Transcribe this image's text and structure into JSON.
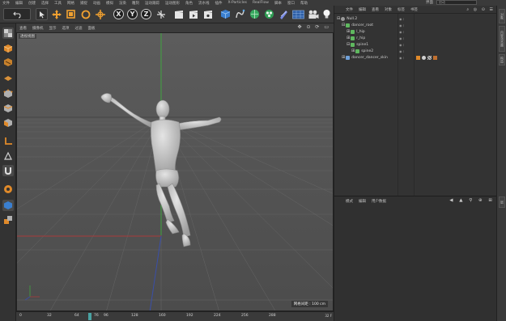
{
  "menu": {
    "items": [
      "文件",
      "编辑",
      "创建",
      "选择",
      "工具",
      "网格",
      "捕捉",
      "动画",
      "模拟",
      "渲染",
      "雕刻",
      "运动跟踪",
      "运动图形",
      "角色",
      "流水线",
      "插件",
      "X-Particles",
      "RealFlow",
      "脚本",
      "窗口",
      "帮助"
    ],
    "layout_label": "界面",
    "layout_value": "启动"
  },
  "toolbar": {
    "undo_icon": "undo-icon",
    "axis_x": "X",
    "axis_y": "Y",
    "axis_z": "Z",
    "accent": "#f0a030"
  },
  "viewport": {
    "menu": [
      "查看",
      "摄像机",
      "显示",
      "选项",
      "过滤",
      "面板"
    ],
    "camera_label": "透视视图",
    "grid_distance": "网格间距 : 100 cm",
    "nav_icons": "✥ ⊙ ⟳ ▭",
    "bg_color": "#5a5a5a",
    "grid_color": "#6b6b6b",
    "y_axis_color": "#3fa53f",
    "x_axis_color": "#a83a3a",
    "z_axis_color": "#3a4fa8"
  },
  "timeline": {
    "ticks": [
      "0",
      "32",
      "64",
      "96",
      "128",
      "160",
      "192",
      "224",
      "256",
      "288"
    ],
    "current_frame": "76",
    "end_label": "32 F"
  },
  "object_manager": {
    "tabs": [
      "文件",
      "编辑",
      "查看",
      "对象",
      "标签",
      "书签"
    ],
    "objects": [
      {
        "name": "Null.2",
        "indent": 0,
        "icon_color": "#9a9a9a"
      },
      {
        "name": "dancer_root",
        "indent": 1,
        "icon_color": "#5fb85f"
      },
      {
        "name": "l_hip",
        "indent": 2,
        "icon_color": "#5fb85f"
      },
      {
        "name": "r_hip",
        "indent": 2,
        "icon_color": "#5fb85f"
      },
      {
        "name": "spine1",
        "indent": 2,
        "icon_color": "#5fb85f"
      },
      {
        "name": "spine2",
        "indent": 3,
        "icon_color": "#5fb85f"
      },
      {
        "name": "dancer_dancer_skin",
        "indent": 1,
        "icon_color": "#6fa0d8"
      }
    ]
  },
  "attributes": {
    "tabs": [
      "模式",
      "编辑",
      "用户数据"
    ],
    "icons": "◀ ▲ ⚲ ⊕ ⊞"
  },
  "right_strip": {
    "tabs": [
      "对象",
      "内容浏览器",
      "构造",
      "层"
    ]
  }
}
